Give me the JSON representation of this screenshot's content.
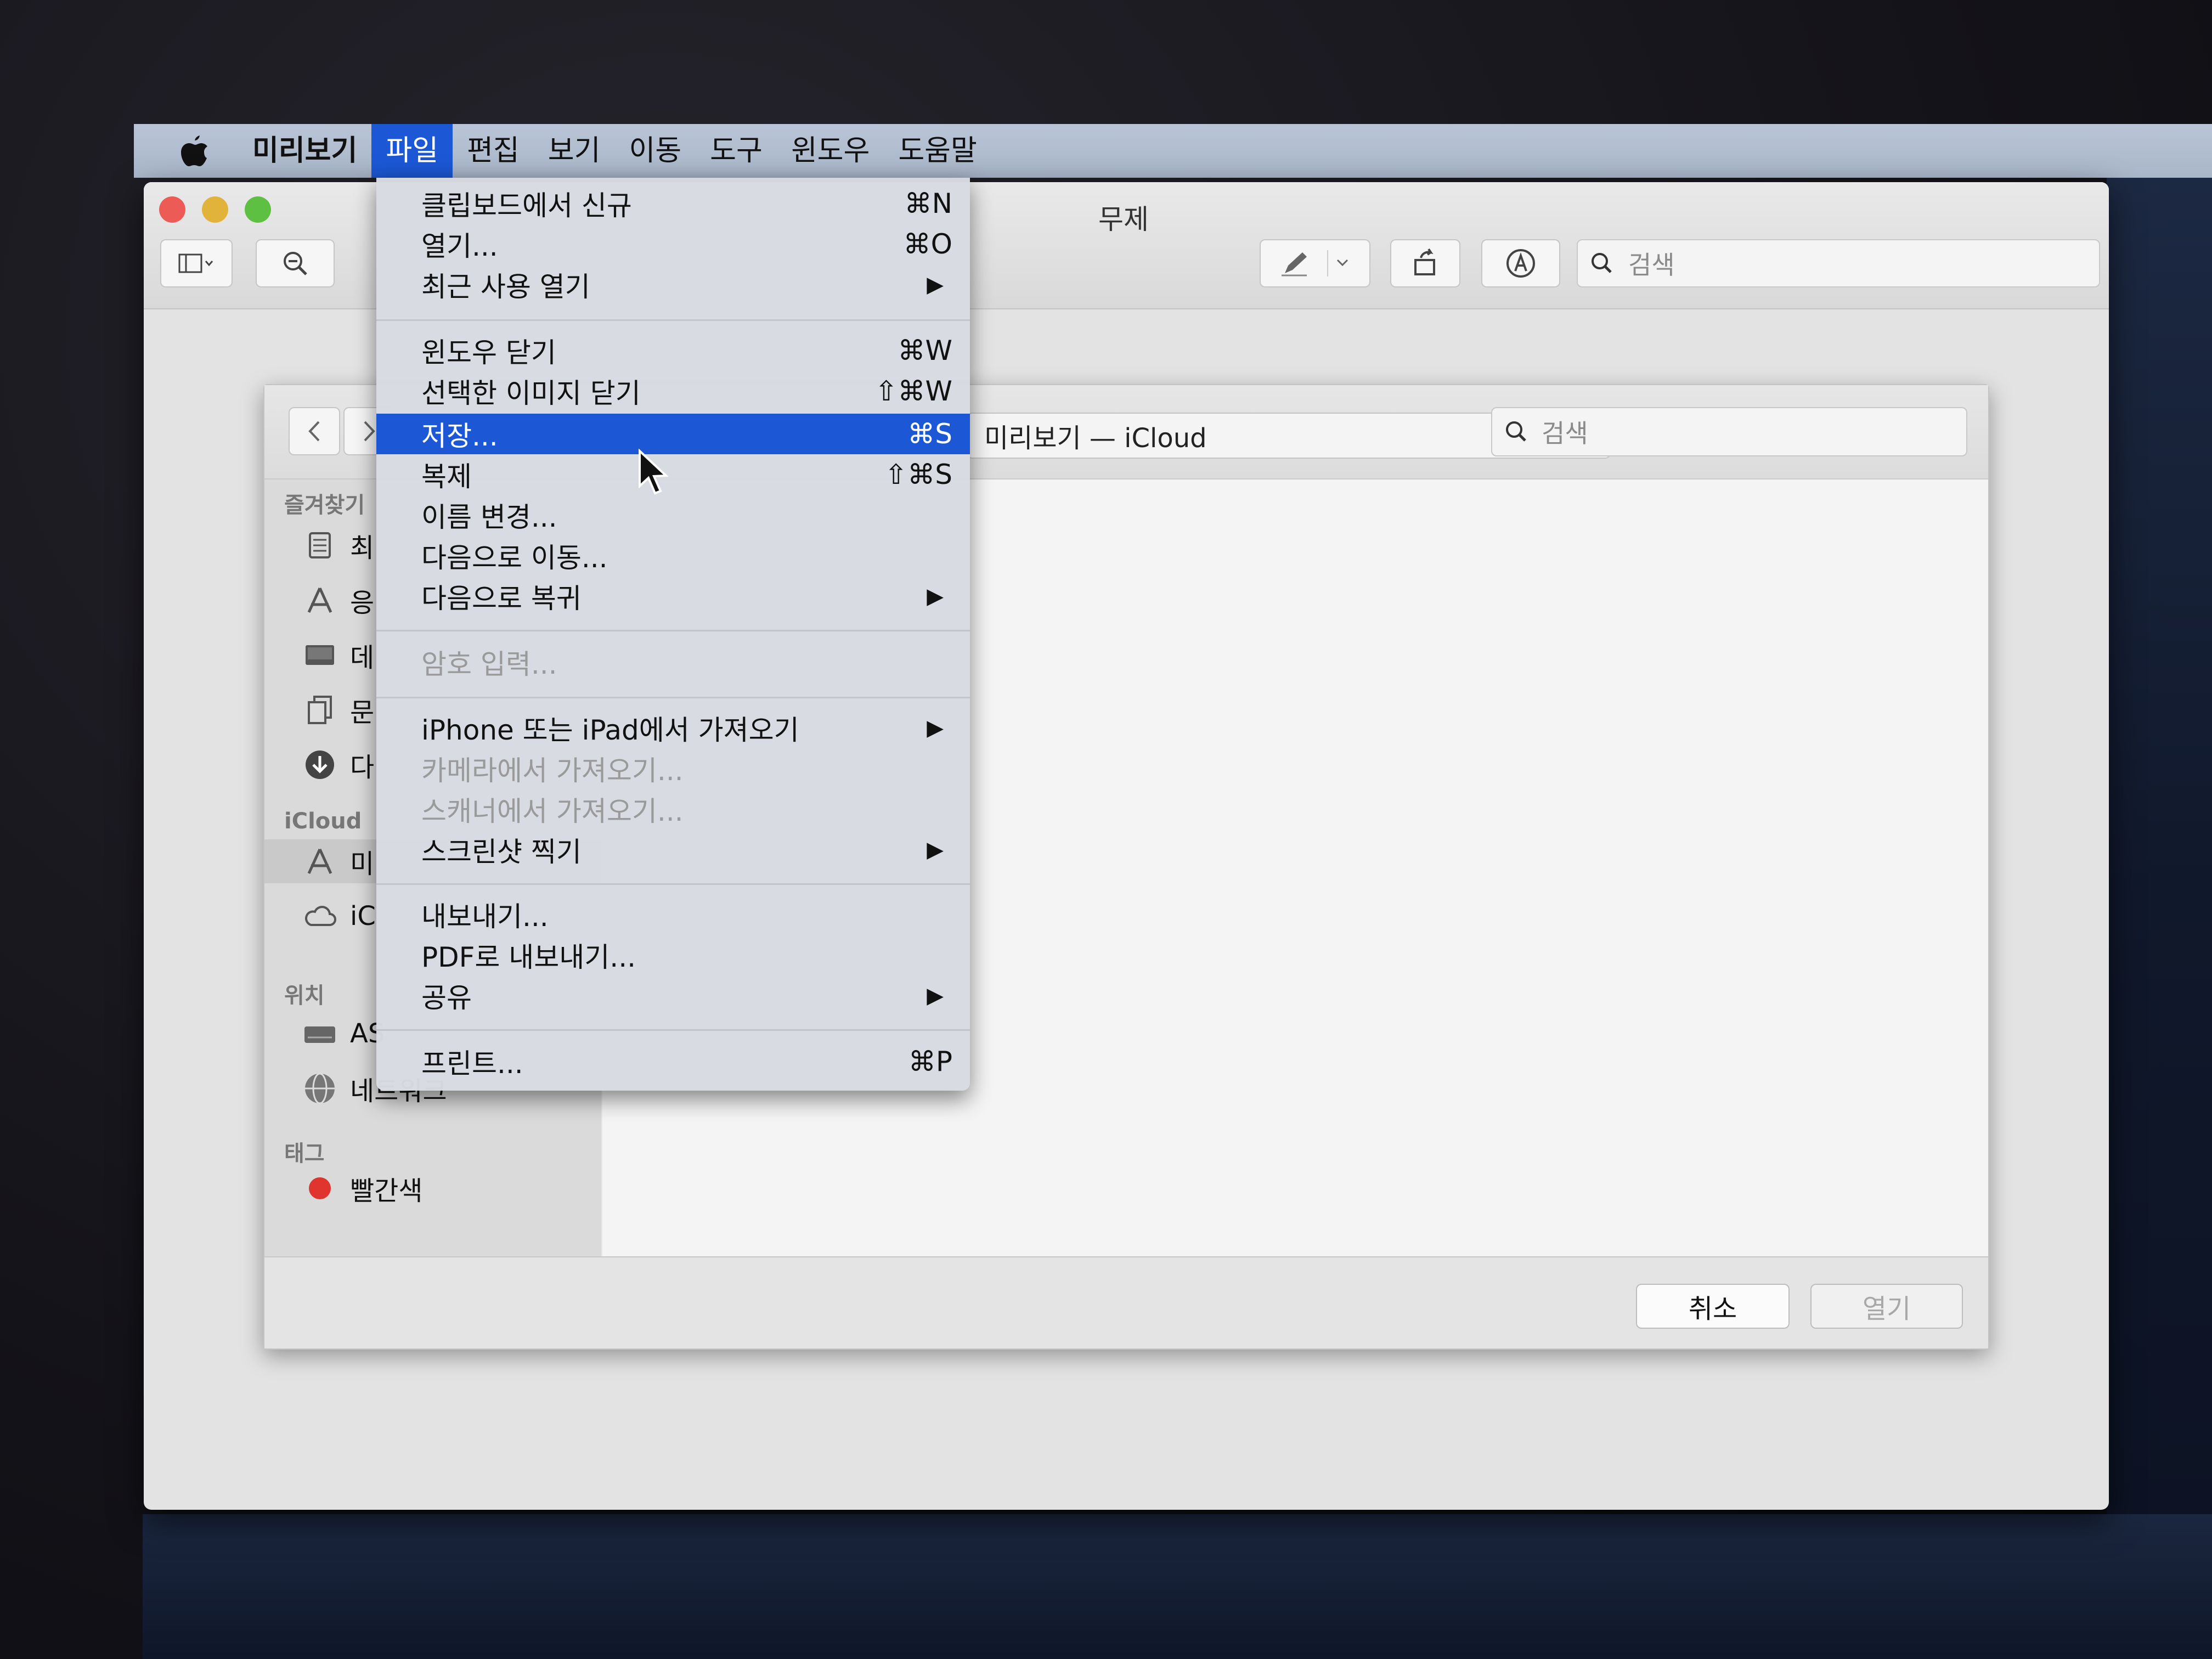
{
  "menubar": {
    "items": [
      "미리보기",
      "파일",
      "편집",
      "보기",
      "이동",
      "도구",
      "윈도우",
      "도움말"
    ],
    "active": "파일"
  },
  "window": {
    "title": "무제",
    "search_placeholder": "검색"
  },
  "file_menu": {
    "items": [
      {
        "label": "클립보드에서 신규",
        "shortcut": "⌘N"
      },
      {
        "label": "열기...",
        "shortcut": "⌘O"
      },
      {
        "label": "최근 사용 열기",
        "submenu": "▶"
      },
      {
        "label": "윈도우 닫기",
        "shortcut": "⌘W"
      },
      {
        "label": "선택한 이미지 닫기",
        "shortcut": "⇧⌘W"
      },
      {
        "label": "저장...",
        "shortcut": "⌘S"
      },
      {
        "label": "복제",
        "shortcut": "⇧⌘S"
      },
      {
        "label": "이름 변경..."
      },
      {
        "label": "다음으로 이동..."
      },
      {
        "label": "다음으로 복귀",
        "submenu": "▶"
      },
      {
        "label": "암호 입력..."
      },
      {
        "label": "iPhone 또는 iPad에서 가져오기",
        "submenu": "▶"
      },
      {
        "label": "카메라에서 가져오기..."
      },
      {
        "label": "스캐너에서 가져오기..."
      },
      {
        "label": "스크린샷 찍기",
        "submenu": "▶"
      },
      {
        "label": "내보내기..."
      },
      {
        "label": "PDF로 내보내기..."
      },
      {
        "label": "공유",
        "submenu": "▶"
      },
      {
        "label": "프린트...",
        "shortcut": "⌘P"
      }
    ]
  },
  "sheet": {
    "location": "미리보기 — iCloud",
    "search_placeholder": "검색",
    "sidebar": {
      "favorites_header": "즐겨찾기",
      "favorites": [
        "최",
        "응",
        "데",
        "문",
        "다"
      ],
      "icloud_header": "iCloud",
      "icloud": [
        "미",
        "iC"
      ],
      "locations_header": "위치",
      "locations": [
        "AS",
        "네트워크"
      ],
      "tags_header": "태그",
      "tags": [
        "빨간색"
      ]
    },
    "cancel_label": "취소",
    "open_label": "열기"
  }
}
